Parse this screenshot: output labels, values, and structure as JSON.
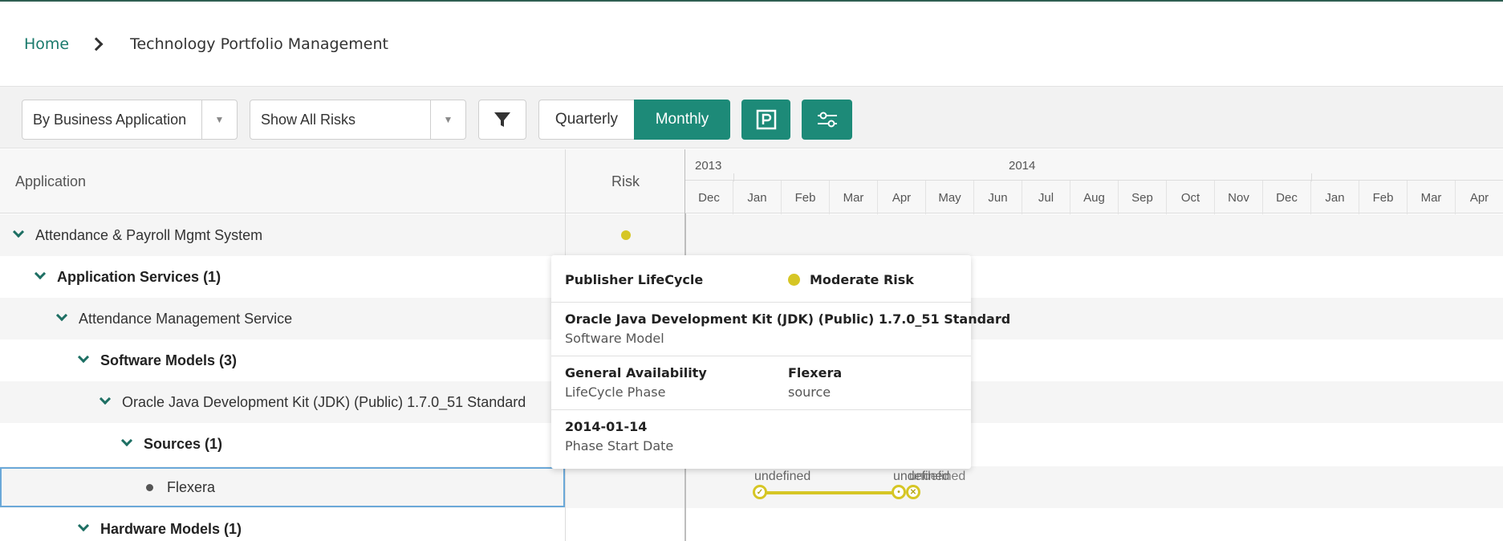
{
  "breadcrumb": {
    "home": "Home",
    "current": "Technology Portfolio Management"
  },
  "toolbar": {
    "group_by": "By Business Application",
    "risk_filter": "Show All Risks",
    "view_quarterly": "Quarterly",
    "view_monthly": "Monthly",
    "accent": "#1d8a78"
  },
  "grid": {
    "col_application": "Application",
    "col_risk": "Risk",
    "years": [
      "2013",
      "2014"
    ],
    "months": [
      "Dec",
      "Jan",
      "Feb",
      "Mar",
      "Apr",
      "May",
      "Jun",
      "Jul",
      "Aug",
      "Sep",
      "Oct",
      "Nov",
      "Dec",
      "Jan",
      "Feb",
      "Mar",
      "Apr"
    ],
    "rows": [
      {
        "label": "Attendance & Payroll Mgmt System"
      },
      {
        "label": "Application Services (1)"
      },
      {
        "label": "Attendance Management Service"
      },
      {
        "label": "Software Models (3)"
      },
      {
        "label": "Oracle Java Development Kit (JDK) (Public) 1.7.0_51 Standard"
      },
      {
        "label": "Sources (1)"
      },
      {
        "label": "Flexera"
      },
      {
        "label": "Hardware Models (1)"
      }
    ]
  },
  "timeline": {
    "label_start": "undefined",
    "label_end_a": "undefined",
    "label_end_b": "undefined",
    "risk_color": "#d6c625"
  },
  "tooltip": {
    "title": "Publisher LifeCycle",
    "risk": "Moderate Risk",
    "model_name": "Oracle Java Development Kit (JDK) (Public) 1.7.0_51 Standard",
    "model_type": "Software Model",
    "phase_value": "General Availability",
    "phase_label": "LifeCycle Phase",
    "source_value": "Flexera",
    "source_label": "source",
    "date_value": "2014-01-14",
    "date_label": "Phase Start Date"
  }
}
